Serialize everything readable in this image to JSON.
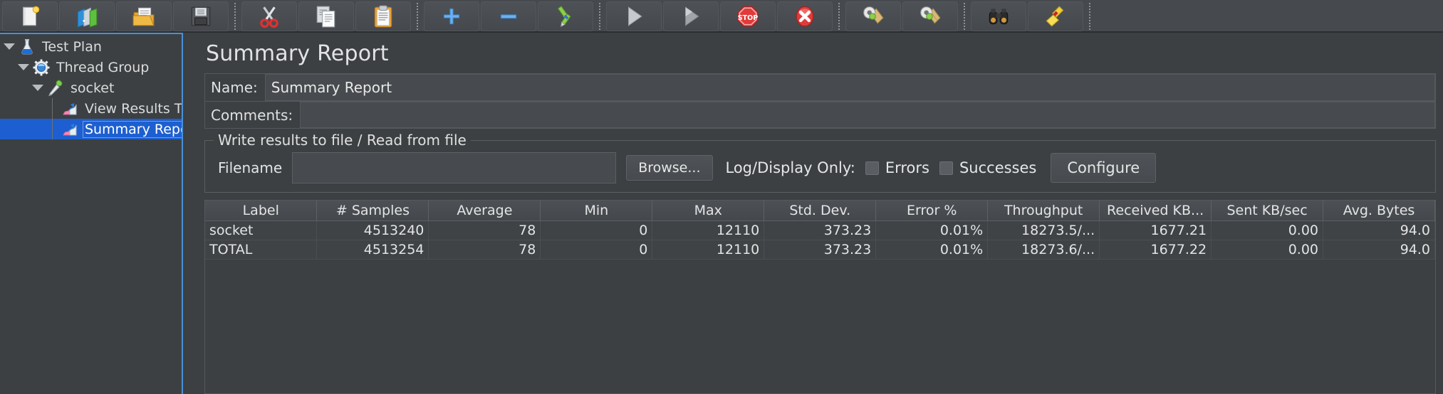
{
  "toolbar": {
    "buttons": [
      {
        "name": "new-button",
        "icon": "new-document-icon"
      },
      {
        "name": "templates-button",
        "icon": "templates-folders-icon"
      },
      {
        "name": "open-button",
        "icon": "open-folder-icon"
      },
      {
        "name": "save-button",
        "icon": "save-floppy-icon"
      },
      {
        "name": "separator-1",
        "icon": "separator"
      },
      {
        "name": "cut-button",
        "icon": "scissors-icon"
      },
      {
        "name": "copy-button",
        "icon": "copy-pages-icon"
      },
      {
        "name": "paste-button",
        "icon": "clipboard-paste-icon"
      },
      {
        "name": "separator-2",
        "icon": "separator"
      },
      {
        "name": "expand-all-button",
        "icon": "plus-icon"
      },
      {
        "name": "collapse-all-button",
        "icon": "minus-icon"
      },
      {
        "name": "toggle-button",
        "icon": "toggle-pencils-icon"
      },
      {
        "name": "separator-3",
        "icon": "separator"
      },
      {
        "name": "start-button",
        "icon": "play-triangle-icon"
      },
      {
        "name": "start-no-timers-button",
        "icon": "play-gray-triangle-icon"
      },
      {
        "name": "stop-button",
        "icon": "stop-sign-icon"
      },
      {
        "name": "shutdown-button",
        "icon": "shutdown-x-icon"
      },
      {
        "name": "separator-4",
        "icon": "separator"
      },
      {
        "name": "clear-button",
        "icon": "broom-gear-icon"
      },
      {
        "name": "clear-all-button",
        "icon": "broom-gear-all-icon"
      },
      {
        "name": "separator-5",
        "icon": "separator"
      },
      {
        "name": "search-button",
        "icon": "binoculars-icon"
      },
      {
        "name": "reset-search-button",
        "icon": "yellow-broom-icon"
      },
      {
        "name": "separator-6",
        "icon": "separator"
      }
    ]
  },
  "tree": {
    "items": [
      {
        "label": "Test Plan",
        "icon": "test-plan-flask-icon",
        "depth": 0,
        "twisty": "expanded",
        "selected": false
      },
      {
        "label": "Thread Group",
        "icon": "thread-group-gear-icon",
        "depth": 1,
        "twisty": "expanded",
        "selected": false
      },
      {
        "label": "socket",
        "icon": "sampler-pipette-icon",
        "depth": 2,
        "twisty": "expanded",
        "selected": false
      },
      {
        "label": "View Results Tree",
        "icon": "listener-chart-icon",
        "depth": 3,
        "twisty": "none",
        "selected": false
      },
      {
        "label": "Summary Report",
        "icon": "listener-chart-icon",
        "depth": 3,
        "twisty": "none",
        "selected": true
      }
    ]
  },
  "main": {
    "title": "Summary Report",
    "name_label": "Name:",
    "name_value": "Summary Report",
    "comments_label": "Comments:",
    "comments_value": "",
    "file_group_legend": "Write results to file / Read from file",
    "filename_label": "Filename",
    "filename_value": "",
    "browse_label": "Browse...",
    "log_display_only_label": "Log/Display Only:",
    "errors_label": "Errors",
    "errors_checked": false,
    "successes_label": "Successes",
    "successes_checked": false,
    "configure_label": "Configure"
  },
  "table": {
    "columns": [
      {
        "label": "Label",
        "align": "left",
        "width": "7.3%"
      },
      {
        "label": "# Samples",
        "align": "right",
        "width": "7.3%"
      },
      {
        "label": "Average",
        "align": "right",
        "width": "7.3%"
      },
      {
        "label": "Min",
        "align": "right",
        "width": "7.3%"
      },
      {
        "label": "Max",
        "align": "right",
        "width": "7.3%"
      },
      {
        "label": "Std. Dev.",
        "align": "right",
        "width": "7.3%"
      },
      {
        "label": "Error %",
        "align": "right",
        "width": "7.3%"
      },
      {
        "label": "Throughput",
        "align": "right",
        "width": "7.3%"
      },
      {
        "label": "Received KB...",
        "align": "right",
        "width": "7.3%"
      },
      {
        "label": "Sent KB/sec",
        "align": "right",
        "width": "7.3%"
      },
      {
        "label": "Avg. Bytes",
        "align": "right",
        "width": "7.3%"
      }
    ],
    "rows": [
      [
        "socket",
        "4513240",
        "78",
        "0",
        "12110",
        "373.23",
        "0.01%",
        "18273.5/...",
        "1677.21",
        "0.00",
        "94.0"
      ],
      [
        "TOTAL",
        "4513254",
        "78",
        "0",
        "12110",
        "373.23",
        "0.01%",
        "18273.6/...",
        "1677.22",
        "0.00",
        "94.0"
      ]
    ]
  },
  "colors": {
    "background": "#3c4043",
    "toolbar": "#464a4e",
    "selection": "#1d5fd0",
    "panel_border": "#4a90d9",
    "text": "#e3e3e3"
  }
}
